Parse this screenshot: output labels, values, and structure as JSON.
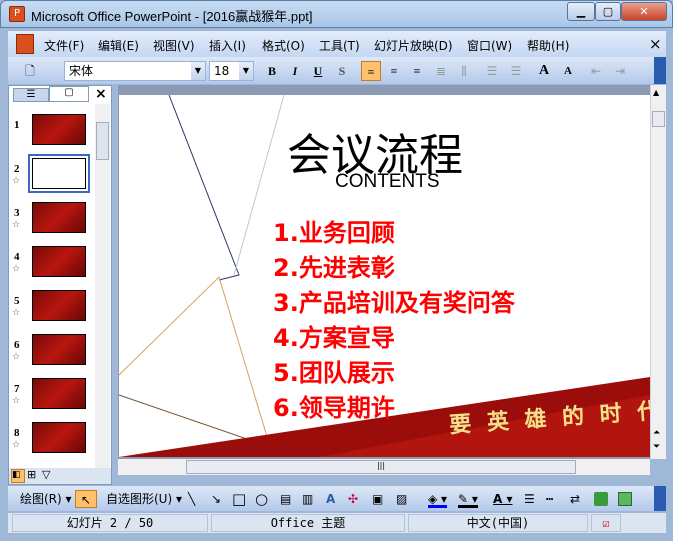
{
  "window": {
    "title": "Microsoft Office PowerPoint - [2016赢战猴年.ppt]",
    "min": "▁",
    "max": "▢",
    "close": "✕"
  },
  "menu": {
    "items": [
      "文件(F)",
      "编辑(E)",
      "视图(V)",
      "插入(I)",
      "格式(O)",
      "工具(T)",
      "幻灯片放映(D)",
      "窗口(W)",
      "帮助(H)"
    ],
    "close": "×"
  },
  "toolbar": {
    "font": "宋体",
    "size": "18",
    "bold": "B",
    "italic": "I",
    "underline": "U",
    "shadow": "S",
    "grow": "A",
    "shrink": "A"
  },
  "slides_panel": {
    "close": "×",
    "slides": [
      {
        "n": "1"
      },
      {
        "n": "2",
        "selected": true
      },
      {
        "n": "3"
      },
      {
        "n": "4"
      },
      {
        "n": "5"
      },
      {
        "n": "6"
      },
      {
        "n": "7"
      },
      {
        "n": "8"
      }
    ]
  },
  "slide": {
    "title": "会议流程",
    "subtitle": "CONTENTS",
    "items": [
      "1.业务回顾",
      "2.先进表彰",
      "3.产品培训及有奖问答",
      "4.方案宣导",
      "5.团队展示",
      "6.领导期许"
    ],
    "banner": "要 英 雄 的 时 代"
  },
  "drawing": {
    "draw": "绘图(R)",
    "autoshapes": "自选图形(U)"
  },
  "status": {
    "slide": "幻灯片 2 / 50",
    "theme": "Office 主题",
    "lang": "中文(中国)"
  },
  "colors": {
    "accent": "#ff0000",
    "selection": "#ffc06a",
    "banner": "#9b0d0a"
  }
}
